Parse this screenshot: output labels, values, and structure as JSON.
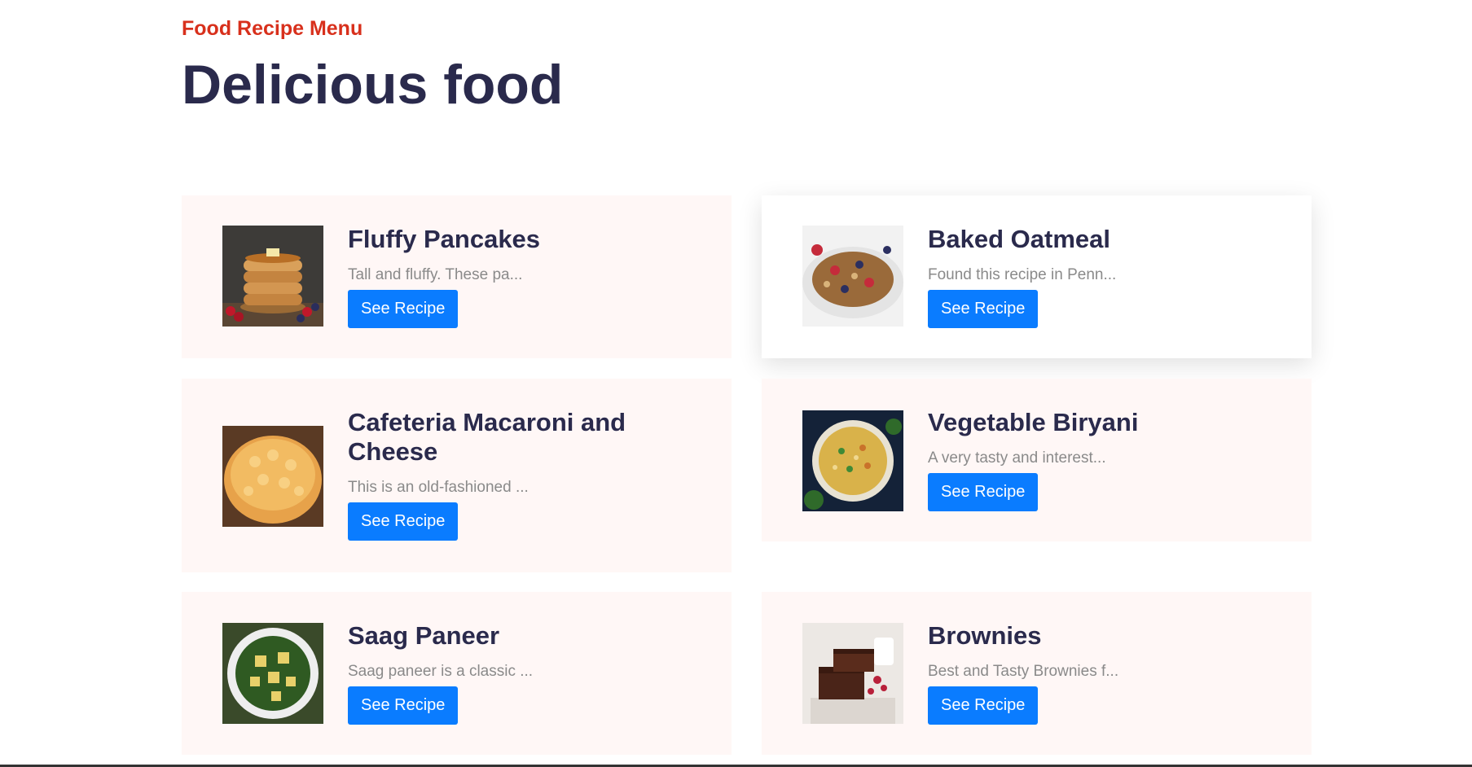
{
  "header": {
    "subtitle": "Food Recipe Menu",
    "title": "Delicious food"
  },
  "recipes": [
    {
      "name": "Fluffy Pancakes",
      "desc": "Tall and fluffy. These pa...",
      "button": "See Recipe",
      "image": "pancakes-image"
    },
    {
      "name": "Baked Oatmeal",
      "desc": "Found this recipe in Penn...",
      "button": "See Recipe",
      "image": "oatmeal-image"
    },
    {
      "name": "Cafeteria Macaroni and Cheese",
      "desc": "This is an old-fashioned ...",
      "button": "See Recipe",
      "image": "macaroni-image"
    },
    {
      "name": "Vegetable Biryani",
      "desc": "A very tasty and interest...",
      "button": "See Recipe",
      "image": "biryani-image"
    },
    {
      "name": "Saag Paneer",
      "desc": "Saag paneer is a classic ...",
      "button": "See Recipe",
      "image": "saag-paneer-image"
    },
    {
      "name": "Brownies",
      "desc": "Best and Tasty Brownies f...",
      "button": "See Recipe",
      "image": "brownies-image"
    }
  ],
  "colors": {
    "accent": "#d8301c",
    "heading": "#2a2a4c",
    "button": "#0a7cff",
    "card_bg": "#fff7f6"
  }
}
